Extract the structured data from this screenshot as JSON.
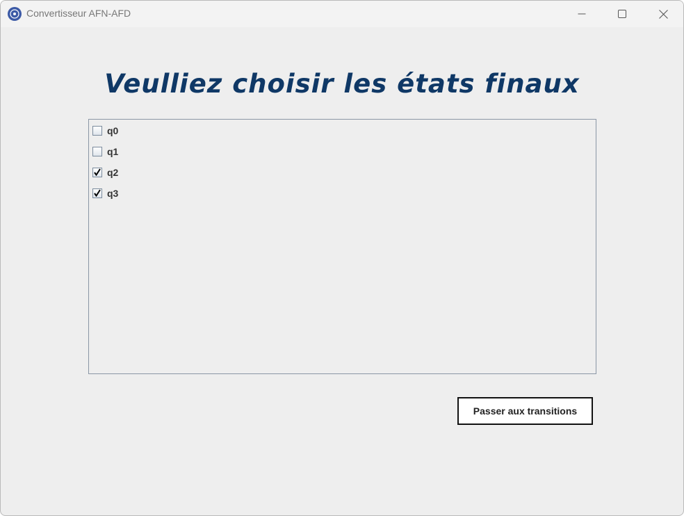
{
  "window": {
    "title": "Convertisseur AFN-AFD",
    "controls": {
      "minimize_icon": "minimize-icon",
      "maximize_icon": "maximize-icon",
      "close_icon": "close-icon"
    }
  },
  "main": {
    "heading": "Veulliez choisir les états finaux",
    "states": [
      {
        "label": "q0",
        "checked": false
      },
      {
        "label": "q1",
        "checked": false
      },
      {
        "label": "q2",
        "checked": true
      },
      {
        "label": "q3",
        "checked": true
      }
    ],
    "next_button_label": "Passer aux transitions"
  },
  "colors": {
    "heading": "#0f3866",
    "background": "#eeeeee",
    "panel_border": "#8a96a5",
    "app_icon": "#3c5aa6"
  }
}
